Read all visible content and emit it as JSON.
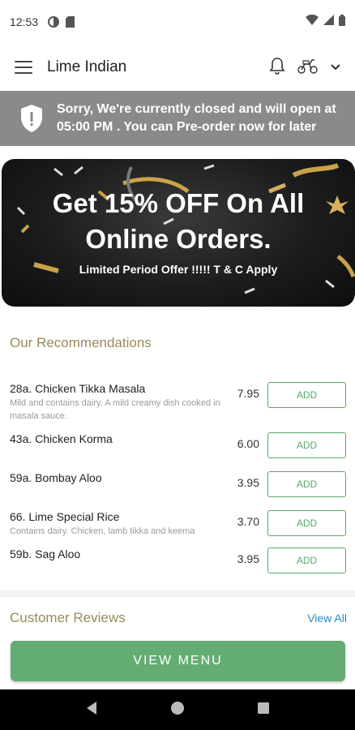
{
  "status_bar": {
    "time": "12:53",
    "icons_left": [
      "data-saver-icon",
      "sim-card-icon"
    ],
    "icons_right": [
      "wifi-icon",
      "signal-icon",
      "battery-icon"
    ]
  },
  "app_bar": {
    "title": "Lime Indian",
    "icons": [
      "menu-icon",
      "bell-icon",
      "delivery-scooter-icon",
      "chevron-down-icon"
    ]
  },
  "closed_banner": {
    "line1": "Sorry, We're currently closed and will open at",
    "line2": "05:00 PM . You can Pre-order now for later",
    "icon": "shield-alert-icon"
  },
  "promo": {
    "line1": "Get 15% OFF On All",
    "line2": "Online Orders.",
    "subtitle": "Limited Period Offer !!!!! T & C Apply"
  },
  "recommendations": {
    "title": "Our Recommendations",
    "add_label": "ADD",
    "items": [
      {
        "name": "28a. Chicken Tikka Masala",
        "description": "Mild and contains dairy. A mild creamy dish cooked in masala sauce.",
        "price": "7.95"
      },
      {
        "name": "43a. Chicken Korma",
        "description": "",
        "price": "6.00"
      },
      {
        "name": "59a. Bombay Aloo",
        "description": "",
        "price": "3.95"
      },
      {
        "name": "66. Lime Special Rice",
        "description": "Contains dairy. Chicken, lamb tikka and keema",
        "price": "3.70"
      },
      {
        "name": "59b. Sag Aloo",
        "description": "",
        "price": "3.95"
      }
    ]
  },
  "reviews": {
    "title": "Customer Reviews",
    "view_all": "View All"
  },
  "view_menu_button": "VIEW MENU",
  "nav_bar": {
    "icons": [
      "back-icon",
      "home-icon",
      "recents-icon"
    ]
  },
  "colors": {
    "accent_green": "#63ad72",
    "section_title_gold": "#9a8a5a",
    "link_blue": "#2a8bbf",
    "banner_gray": "#8a8a8a"
  }
}
